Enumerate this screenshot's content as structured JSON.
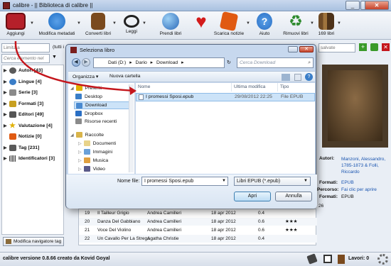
{
  "window": {
    "title": "calibre - || Biblioteca di calibre ||"
  },
  "toolbar": {
    "buttons": [
      {
        "label": "Aggiungi",
        "icon": "add-books-icon",
        "color": "#b5202a"
      },
      {
        "label": "Modifica metadati",
        "icon": "info-icon",
        "color": "#1f6fc6"
      },
      {
        "label": "Converti libri",
        "icon": "book-convert-icon",
        "color": "#7a4a1e"
      },
      {
        "label": "Leggi",
        "icon": "glasses-icon",
        "color": "#222222"
      },
      {
        "label": "Prendi libri",
        "icon": "globe-icon",
        "color": "#2a68b8"
      },
      {
        "label": "Dona",
        "icon": "heart-icon",
        "color": "#d31b1b"
      },
      {
        "label": "Scarica notizie",
        "icon": "news-icon",
        "color": "#e05a12"
      },
      {
        "label": "Aiuto",
        "icon": "help-icon",
        "color": "#2a6fc4"
      },
      {
        "label": "Rimuovi libri",
        "icon": "recycle-icon",
        "color": "#2e8b2e"
      },
      {
        "label": "169 libri",
        "icon": "library-icon",
        "color": "#6e4a26"
      }
    ]
  },
  "filters": {
    "limit_placeholder": "Limita a",
    "tutti_fragment": "(tutti i",
    "search_placeholder": "Cerca elemento nel navigatore",
    "saved_searches": "salvate"
  },
  "sidebar": {
    "items": [
      {
        "label": "Autori [43]",
        "icon": "authors-icon",
        "color": "#5a5a5a"
      },
      {
        "label": "Lingue [4]",
        "icon": "languages-icon",
        "color": "#3a7ec8"
      },
      {
        "label": "Serie [3]",
        "icon": "series-icon",
        "color": "#8a8a8a"
      },
      {
        "label": "Formati [3]",
        "icon": "formats-icon",
        "color": "#c8a020"
      },
      {
        "label": "Editori [49]",
        "icon": "publishers-icon",
        "color": "#555555"
      },
      {
        "label": "Valutazione [4]",
        "icon": "rating-icon",
        "color": "#e0b000"
      },
      {
        "label": "Notizie [0]",
        "icon": "news-icon",
        "color": "#e05a12"
      },
      {
        "label": "Tag [231]",
        "icon": "tags-icon",
        "color": "#5a5a5a"
      },
      {
        "label": "Identificatori [3]",
        "icon": "identifiers-icon",
        "color": "#333333"
      }
    ],
    "modify_label": "Modifica navigatore tag"
  },
  "books": [
    {
      "num": "19",
      "title": "Il Tailleur Grigio",
      "author": "Andrea Camilleri",
      "date": "18 apr 2012",
      "size": "0.4",
      "rating": ""
    },
    {
      "num": "20",
      "title": "Danza Del Gabbiano",
      "author": "Andrea Camilleri",
      "date": "18 apr 2012",
      "size": "0.6",
      "rating": "★★★"
    },
    {
      "num": "21",
      "title": "Voce Del Violino",
      "author": "Andrea Camilleri",
      "date": "18 apr 2012",
      "size": "0.6",
      "rating": "★★★"
    },
    {
      "num": "22",
      "title": "Un Cavallo Per La Strega",
      "author": "Agatha Christie",
      "date": "18 apr 2012",
      "size": "0.4",
      "rating": ""
    }
  ],
  "details": {
    "authors_label": "Autori:",
    "authors_value": "Manzoni, Alessandro, 1785-1873 & Folli, Riccardo",
    "formats_label": "Formati:",
    "formats_value": "EPUB",
    "path_label": "Percorso:",
    "path_value": "Fai clic per aprire",
    "formats2_label": "Formati:",
    "formats2_value": "EPUB",
    "stray_number": "26"
  },
  "statusbar": {
    "version": "calibre versione 0.8.66 creato da Kovid Goyal",
    "jobs": "Lavori: 0"
  },
  "dialog": {
    "title": "Seleziona libro",
    "path": [
      "Dati (D:)",
      "Dario",
      "Download"
    ],
    "search_placeholder": "Cerca Download",
    "organize": "Organizza",
    "new_folder": "Nuova cartella",
    "nav": {
      "favorites": "Preferiti",
      "desktop": "Desktop",
      "download": "Download",
      "dropbox": "Dropbox",
      "recent": "Risorse recenti",
      "collections": "Raccolte",
      "documents": "Documenti",
      "images": "Immagini",
      "music": "Musica",
      "video": "Video"
    },
    "columns": [
      "Nome",
      "Ultima modifica",
      "Tipo"
    ],
    "file": {
      "name": "I promessi Sposi.epub",
      "modified": "29/08/2012 22:25",
      "type": "File EPUB"
    },
    "filename_label": "Nome file:",
    "filename_value": "I promessi Sposi.epub",
    "filter_value": "Libri EPUB (*.epub)",
    "open_label": "Apri",
    "cancel_label": "Annulla"
  },
  "colors": {
    "accent_red": "#c4161c",
    "selection": "#cce3f8"
  }
}
